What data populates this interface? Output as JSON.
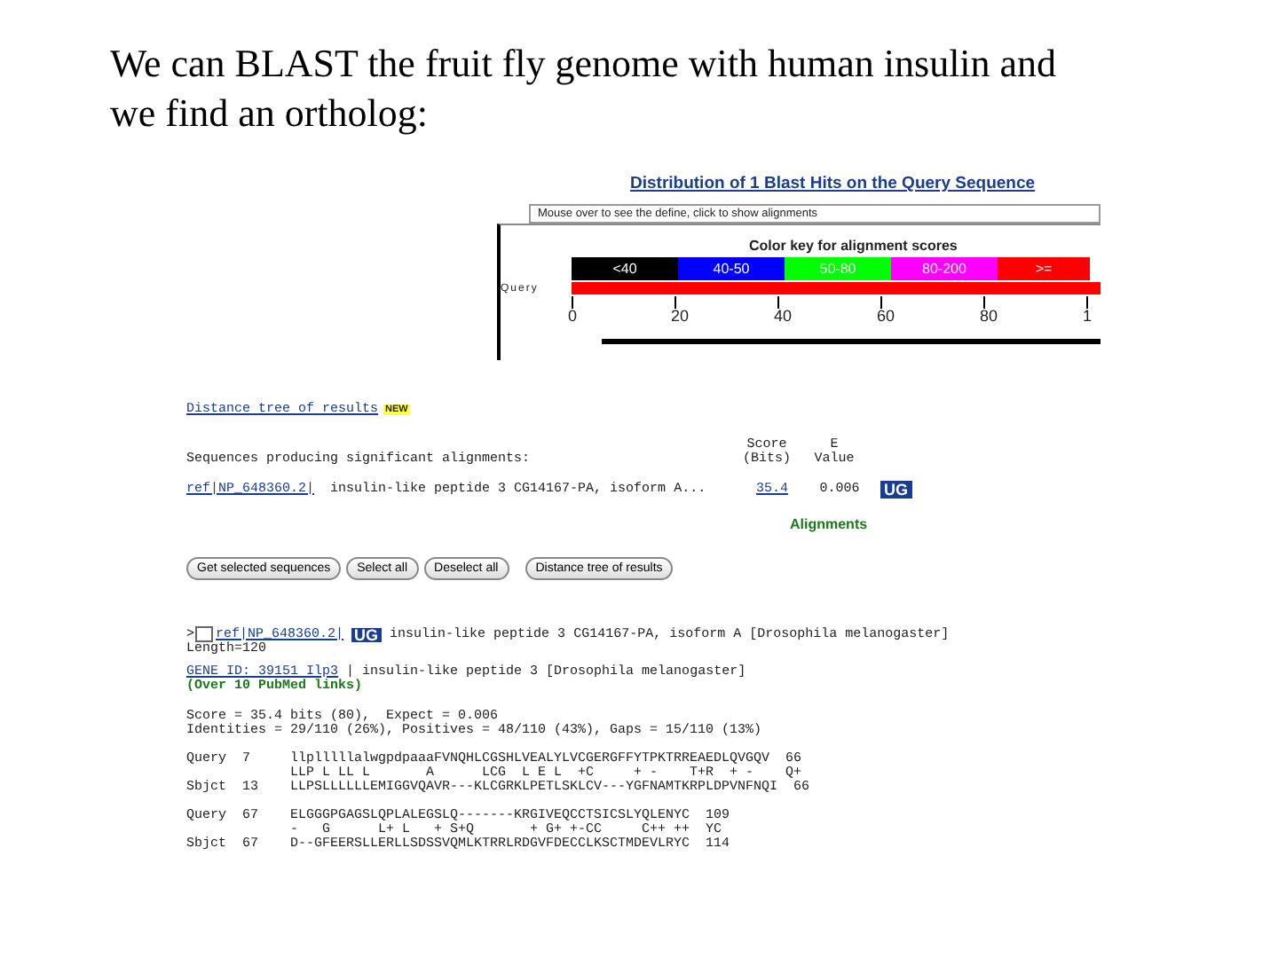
{
  "slide": {
    "title": "We can BLAST the fruit fly genome with human insulin and we find an ortholog:"
  },
  "graphic": {
    "title": "Distribution of 1 Blast Hits on the Query Sequence",
    "hint": "Mouse over to see the define, click to show alignments",
    "key_title": "Color key for alignment scores",
    "query_label": "Query",
    "key": [
      {
        "label": "<40",
        "color": "#000000"
      },
      {
        "label": "40-50",
        "color": "#0000ff"
      },
      {
        "label": "50-80",
        "color": "#00ff00"
      },
      {
        "label": "80-200",
        "color": "#ff00ff"
      },
      {
        "label": ">=",
        "color": "#ff0000"
      }
    ],
    "axis": [
      "0",
      "20",
      "40",
      "60",
      "80",
      "1"
    ]
  },
  "results": {
    "tree_link": "Distance tree of results",
    "new_badge": "NEW",
    "heading": "Sequences producing significant alignments:",
    "score_header": [
      "Score",
      "(Bits)"
    ],
    "evalue_header": [
      "E",
      "Value"
    ],
    "hits": [
      {
        "id": "ref|NP_648360.2|",
        "description": "insulin-like peptide 3 CG14167-PA, isoform A...",
        "score": "35.4",
        "evalue": "0.006",
        "badge": "UG"
      }
    ],
    "alignments_link": "Alignments"
  },
  "buttons": [
    "Get selected sequences",
    "Select all",
    "Deselect all",
    "Distance tree of results"
  ],
  "alignment": {
    "marker": ">",
    "checked": false,
    "id": "ref|NP_648360.2|",
    "badge": "UG",
    "title": "insulin-like peptide 3 CG14167-PA, isoform A [Drosophila melanogaster]",
    "length": "Length=120",
    "gene_link": "GENE ID: 39151 Ilp3",
    "gene_desc": "| insulin-like peptide 3 [Drosophila melanogaster]",
    "pubmed": "(Over 10 PubMed links)",
    "score_line": "Score = 35.4 bits (80),  Expect = 0.006",
    "identities_line": "Identities = 29/110 (26%), Positives = 48/110 (43%), Gaps = 15/110 (13%)",
    "blocks": [
      [
        "Query  7     llplllllalwgpdpaaaFVNQHLCGSHLVEALYLVCGERGFFYTPKTRREAEDLQVGQV  66",
        "             LLP L LL L       A      LCG  L E L  +C     + -    T+R  + -    Q+",
        "Sbjct  13    LLPSLLLLLLEMIGGVQAVR---KLCGRKLPETLSKLCV---YGFNAMTKRPLDPVNFNQI  66"
      ],
      [
        "Query  67    ELGGGPGAGSLQPLALEGSLQ-------KRGIVEQCCTSICSLYQLENYC  109",
        "             -   G      L+ L   + S+Q       + G+ +-CC     C++ ++  YC",
        "Sbjct  67    D--GFEERSLLERLLSDSSVQMLKTRRLRDGVFDECCLKSCTMDEVLRYC  114"
      ]
    ]
  }
}
